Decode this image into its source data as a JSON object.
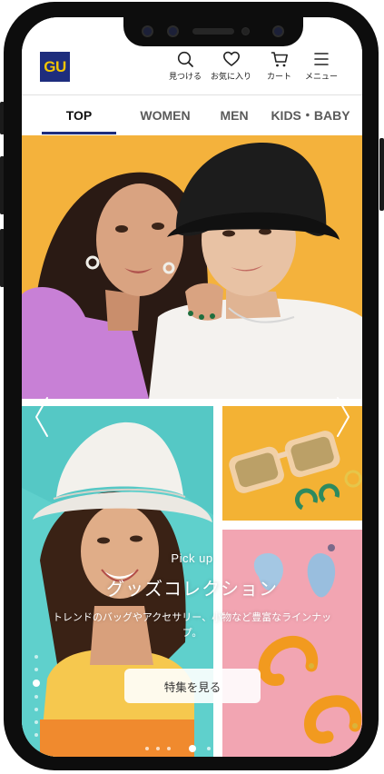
{
  "header": {
    "logo_text": "GU",
    "icons": [
      {
        "name": "search-icon",
        "label": "見つける"
      },
      {
        "name": "heart-icon",
        "label": "お気に入り"
      },
      {
        "name": "cart-icon",
        "label": "カート"
      },
      {
        "name": "menu-icon",
        "label": "メニュー"
      }
    ]
  },
  "tabs": [
    {
      "label": "TOP",
      "active": true
    },
    {
      "label": "WOMEN",
      "active": false
    },
    {
      "label": "MEN",
      "active": false
    },
    {
      "label": "KIDS・BABY",
      "active": false
    }
  ],
  "hero": {
    "pickup": "Pick up",
    "title": "グッズコレクション",
    "description": "トレンドのバッグやアクセサリー、小物など豊富なラインナップ。",
    "cta": "特集を見る",
    "slide_count": 6,
    "active_slide": 4
  },
  "colors": {
    "brand_navy": "#1e2d7d",
    "brand_yellow": "#f2c500",
    "panel_orange": "#f4b23c",
    "panel_teal": "#5fd0cc",
    "panel_pink": "#f2a5b2"
  }
}
